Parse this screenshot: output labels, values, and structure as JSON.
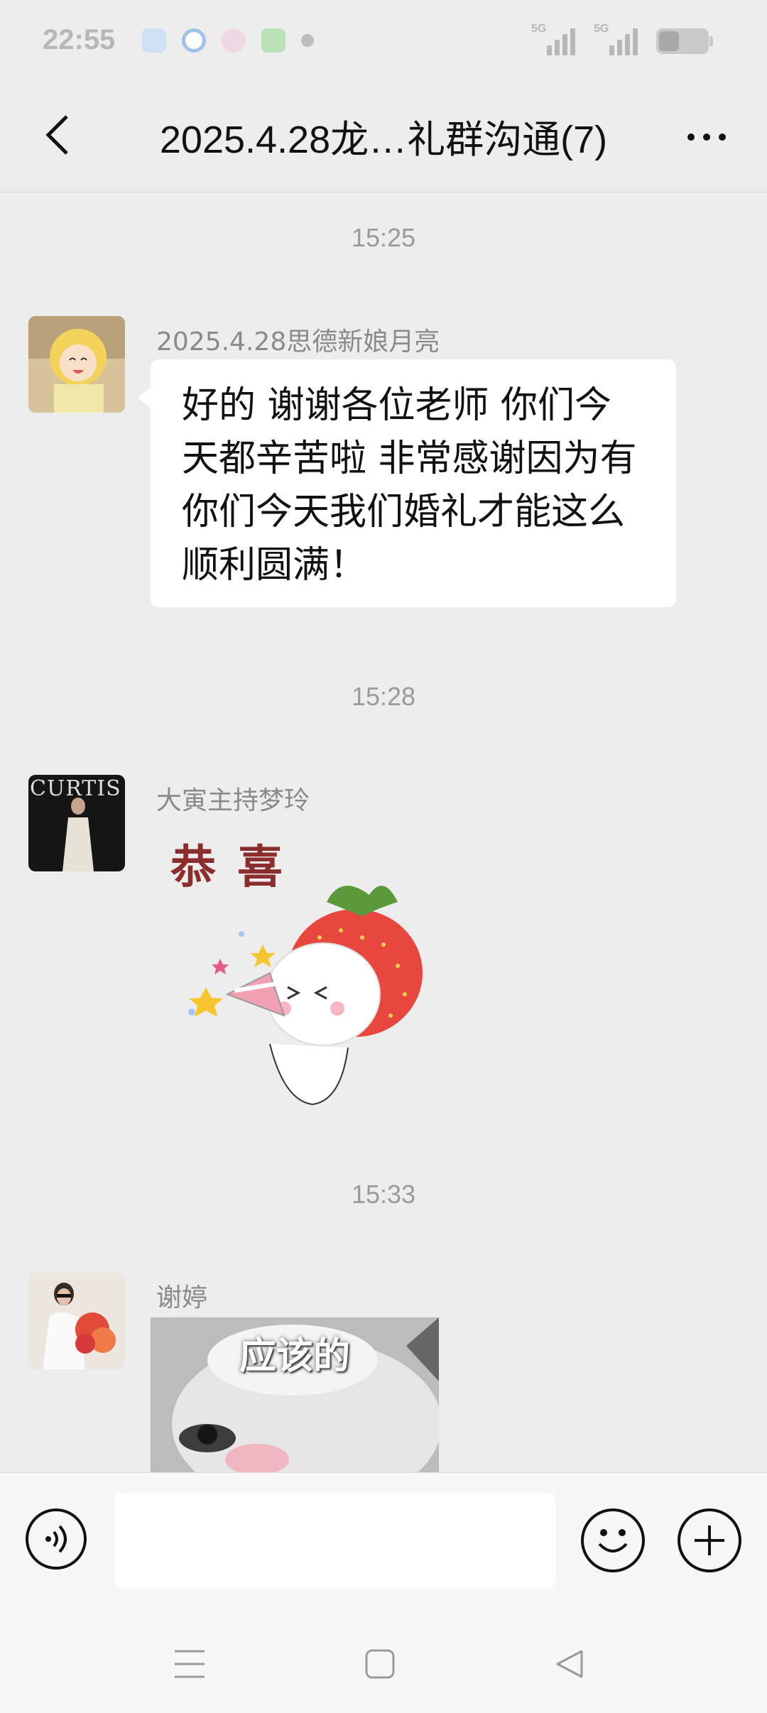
{
  "status_bar": {
    "time": "22:55",
    "signal1_label": "5G",
    "signal2_label": "5G"
  },
  "header": {
    "title": "2025.4.28龙…礼群沟通(7)"
  },
  "messages": [
    {
      "timestamp": "15:25",
      "sender": "2025.4.28思德新娘月亮",
      "text": "好的 谢谢各位老师 你们今天都辛苦啦 非常感谢因为有你们今天我们婚礼才能这么顺利圆满！"
    },
    {
      "timestamp": "15:28",
      "sender": "大寅主持梦玲",
      "avatar_text": "CURTIS",
      "sticker_caption": "恭喜"
    },
    {
      "timestamp": "15:33",
      "sender": "谢婷",
      "image_caption": "应该的"
    }
  ],
  "input": {
    "value": ""
  },
  "colors": {
    "background": "#ededed",
    "bubble": "#ffffff",
    "input_bar": "#f7f7f7"
  },
  "icons": [
    "back-arrow-icon",
    "more-icon",
    "voice-icon",
    "emoji-icon",
    "plus-icon",
    "menu-icon",
    "home-icon",
    "back-triangle-icon"
  ]
}
